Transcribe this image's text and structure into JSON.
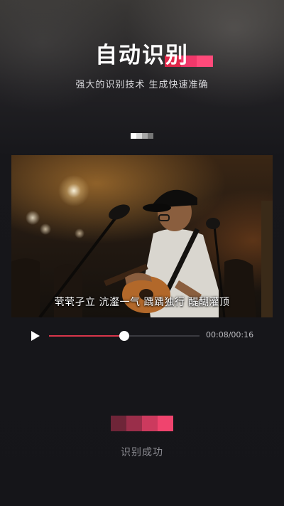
{
  "header": {
    "title": "自动识别",
    "subtitle": "强大的识别技术 生成快速准确",
    "accent_colors": [
      "#e0284a",
      "#f0386a",
      "#ff4a7a"
    ]
  },
  "pager": {
    "dot_colors": [
      "#ffffff",
      "#d9d9d9",
      "#a8a8a8",
      "#777777"
    ]
  },
  "video": {
    "caption": "茕茕孑立 沆瀣一气   踽踽独行 醍醐灌顶"
  },
  "player": {
    "play_icon": "play-icon",
    "current_time": "00:08",
    "total_time": "00:16",
    "time_text": "00:08/00:16",
    "progress": 0.5,
    "progress_color": "#d8354a"
  },
  "result": {
    "status": "识别成功",
    "bar_colors": [
      "#6e2538",
      "#9a2e4a",
      "#cc3a5e",
      "#f0446e"
    ]
  }
}
